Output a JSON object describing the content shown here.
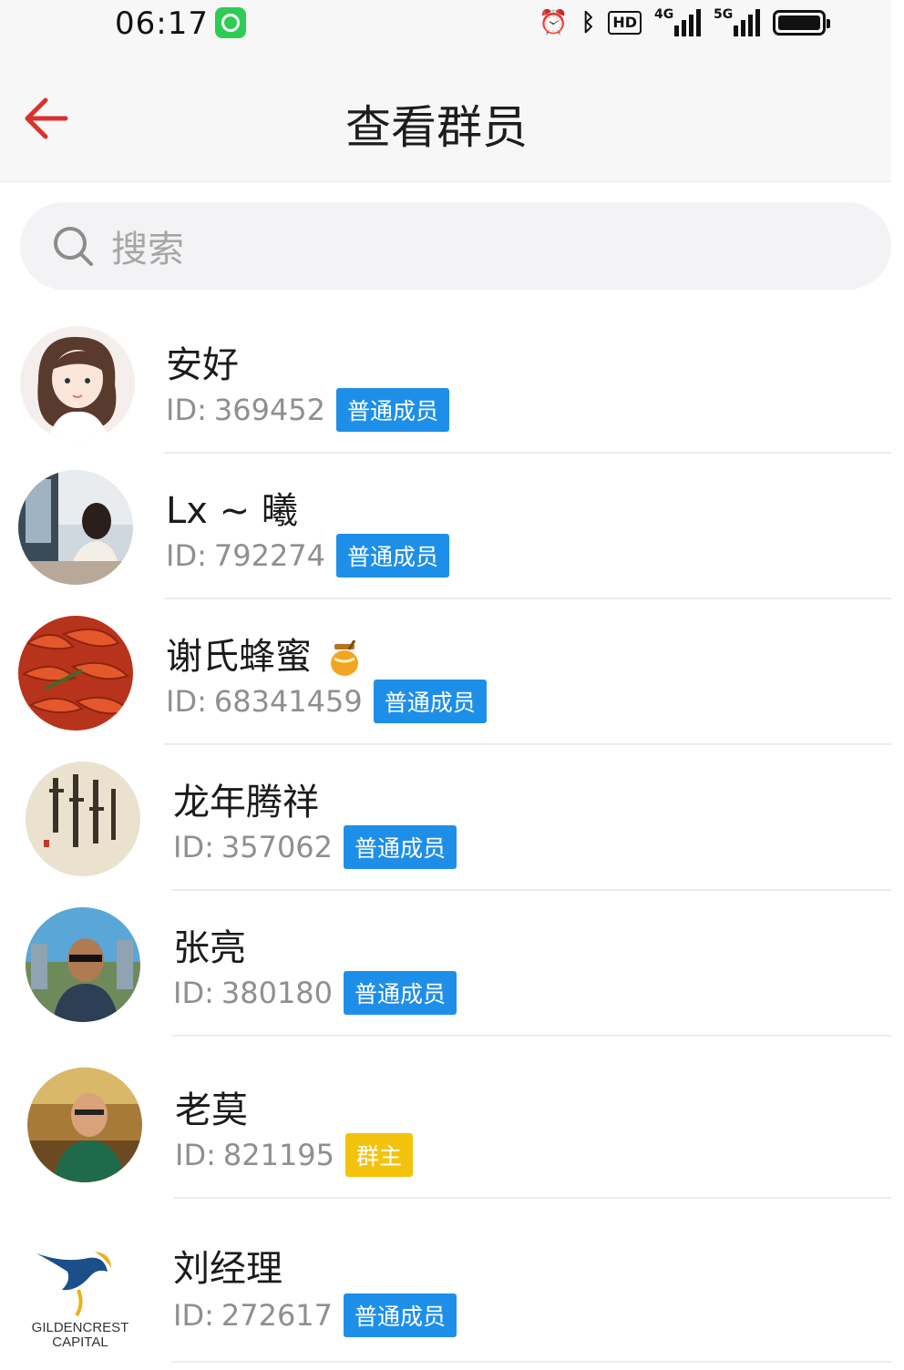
{
  "status_bar": {
    "time": "06:17",
    "net_4g": "4G",
    "net_5g": "5G",
    "hd": "HD"
  },
  "header": {
    "title": "查看群员"
  },
  "search": {
    "placeholder": "搜索"
  },
  "id_prefix": "ID:",
  "members": [
    {
      "name": "安好",
      "id": "369452",
      "role": "普通成员"
    },
    {
      "name": "Lx ~ 曦",
      "id": "792274",
      "role": "普通成员"
    },
    {
      "name": "谢氏蜂蜜",
      "id": "68341459",
      "role": "普通成员"
    },
    {
      "name": "龙年腾祥",
      "id": "357062",
      "role": "普通成员"
    },
    {
      "name": "张亮",
      "id": "380180",
      "role": "普通成员"
    },
    {
      "name": "老莫",
      "id": "821195",
      "role": "群主"
    },
    {
      "name": "刘经理",
      "id": "272617",
      "role": "普通成员"
    }
  ],
  "logo": {
    "line1": "GILDENCREST",
    "line2": "CAPITAL"
  },
  "colors": {
    "accent": "#d8322f",
    "member_badge": "#1e8fe9",
    "owner_badge": "#f3c30c"
  }
}
